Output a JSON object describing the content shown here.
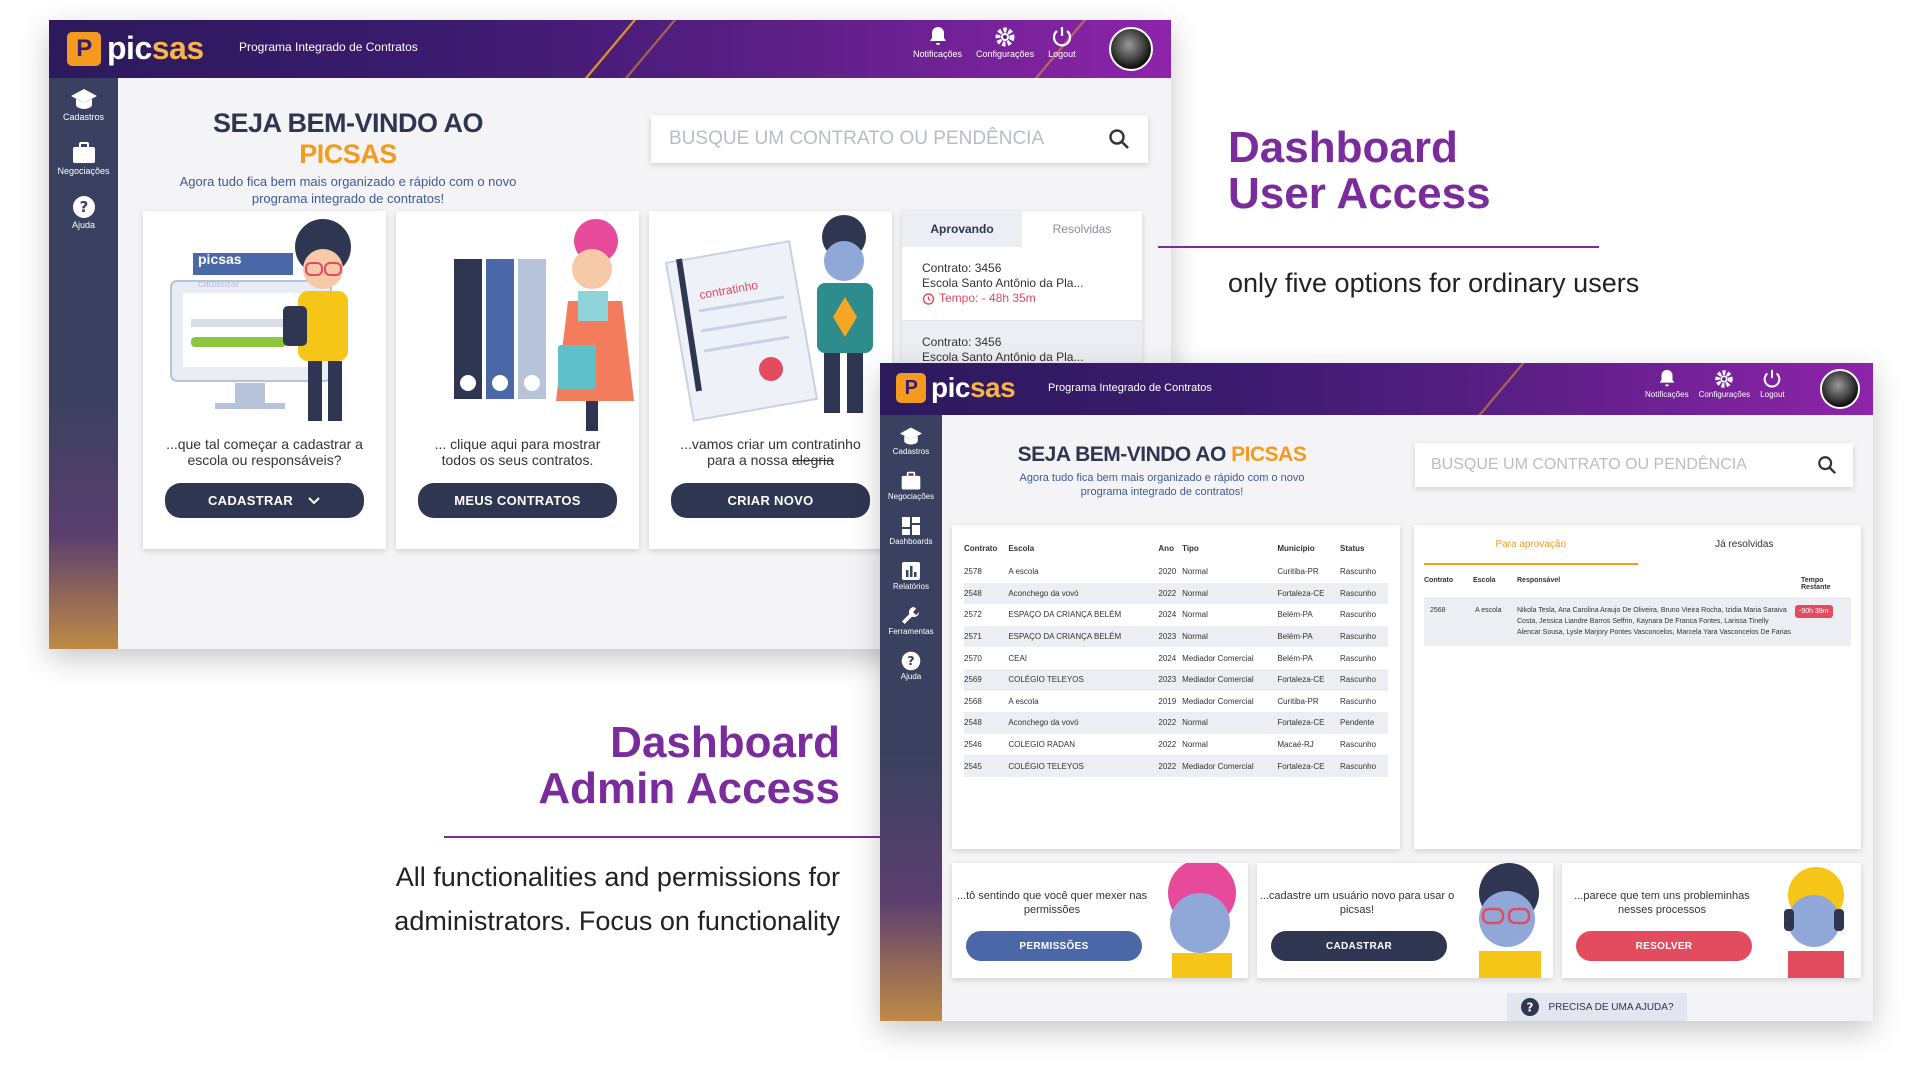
{
  "brand": {
    "logo_letter": "P",
    "name_part1": "pic",
    "name_part2": "sas",
    "tagline": "Programa Integrado de Contratos"
  },
  "topbar": {
    "notifications": "Notificações",
    "settings": "Configurações",
    "logout": "Logout"
  },
  "icons": {
    "notifications": "bell-icon",
    "settings": "gear-icon",
    "logout": "power-icon",
    "search": "search-icon",
    "help": "question-icon"
  },
  "colors": {
    "brand_purple": "#7b2c9c",
    "accent_orange": "#f39a1f",
    "navy": "#2f3651",
    "danger": "#e34b5f",
    "primary_blue": "#4a68a8"
  },
  "welcome": {
    "title_prefix": "SEJA BEM-VINDO AO ",
    "title_brand": "PICSAS",
    "subtitle": "Agora tudo fica bem mais organizado e rápido com o novo programa integrado de contratos!"
  },
  "search": {
    "placeholder": "BUSQUE UM CONTRATO OU PENDÊNCIA"
  },
  "user_dashboard": {
    "sidebar": [
      {
        "label": "Cadastros"
      },
      {
        "label": "Negociações"
      },
      {
        "label": "Ajuda"
      }
    ],
    "cards": [
      {
        "caption": "...que tal começar a cadastrar a escola ou responsáveis?",
        "button": "CADASTRAR",
        "screen_logo": "picsas",
        "screen_field": "cadastrar"
      },
      {
        "caption": "... clique aqui para mostrar todos os seus contratos.",
        "button": "MEUS CONTRATOS"
      },
      {
        "caption_part1": "...vamos criar um contratinho para a nossa ",
        "caption_strike": "alegria",
        "button": "CRIAR NOVO",
        "doc_label": "contratinho"
      }
    ],
    "panel": {
      "tabs": [
        "Aprovando",
        "Resolvidas"
      ],
      "items": [
        {
          "contract": "Contrato: 3456",
          "school": "Escola Santo Antônio da Pla...",
          "time": "Tempo: - 48h 35m"
        },
        {
          "contract": "Contrato: 3456",
          "school": "Escola Santo Antônio da Pla..."
        }
      ]
    }
  },
  "admin_dashboard": {
    "sidebar": [
      {
        "label": "Cadastros"
      },
      {
        "label": "Negociações"
      },
      {
        "label": "Dashboards"
      },
      {
        "label": "Relatórios"
      },
      {
        "label": "Ferramentas"
      },
      {
        "label": "Ajuda"
      }
    ],
    "table": {
      "headers": [
        "Contrato",
        "Escola",
        "Ano",
        "Tipo",
        "Município",
        "Status"
      ],
      "rows": [
        [
          "2578",
          "A escola",
          "2020",
          "Normal",
          "Curitiba-PR",
          "Rascunho"
        ],
        [
          "2548",
          "Aconchego da vovó",
          "2022",
          "Normal",
          "Fortaleza-CE",
          "Rascunho"
        ],
        [
          "2572",
          "ESPAÇO DA CRIANÇA BELÉM",
          "2024",
          "Normal",
          "Belém-PA",
          "Rascunho"
        ],
        [
          "2571",
          "ESPAÇO DA CRIANÇA BELÉM",
          "2023",
          "Normal",
          "Belém-PA",
          "Rascunho"
        ],
        [
          "2570",
          "CEAI",
          "2024",
          "Mediador Comercial",
          "Belém-PA",
          "Rascunho"
        ],
        [
          "2569",
          "COLÉGIO TELEYOS",
          "2023",
          "Mediador Comercial",
          "Fortaleza-CE",
          "Rascunho"
        ],
        [
          "2568",
          "A escola",
          "2019",
          "Mediador Comercial",
          "Curitiba-PR",
          "Rascunho"
        ],
        [
          "2548",
          "Aconchego da vovó",
          "2022",
          "Normal",
          "Fortaleza-CE",
          "Pendente"
        ],
        [
          "2546",
          "COLEGIO RADAN",
          "2022",
          "Normal",
          "Macaé-RJ",
          "Rascunho"
        ],
        [
          "2545",
          "COLÉGIO TELEYOS",
          "2022",
          "Mediador Comercial",
          "Fortaleza-CE",
          "Rascunho"
        ]
      ]
    },
    "approval": {
      "tabs": [
        "Para aprovação",
        "Já resolvidas"
      ],
      "headers": [
        "Contrato",
        "Escola",
        "Responsável",
        "Tempo Restante"
      ],
      "row": {
        "contract": "2568",
        "school": "A escola",
        "responsible": "Nikola Tesla, Ana Carolina Araujo De Oliveira, Bruno Vieira Rocha, Izidia Maria Saraiva Costa, Jessica Liandre Barros Seffrin, Kaynara De Franca Fontes, Larissa Tinelly Alencar Sousa, Lysle Marjory Pontes Vasconcelos, Marcela Yara Vasconcelos De Farias",
        "time": "-90h 39m"
      }
    },
    "cards": [
      {
        "caption": "...tô sentindo que você quer mexer nas permissões",
        "button": "PERMISSÕES"
      },
      {
        "caption": "...cadastre um usuário novo para usar o picsas!",
        "button": "CADASTRAR"
      },
      {
        "caption": "...parece que tem uns probleminhas nesses processos",
        "button": "RESOLVER"
      }
    ],
    "help_button": "PRECISA DE UMA AJUDA?"
  },
  "annotations": {
    "user": {
      "title_line1": "Dashboard",
      "title_line2": "User Access",
      "description": "only five options for ordinary users"
    },
    "admin": {
      "title_line1": "Dashboard",
      "title_line2": "Admin Access",
      "description_line1": "All functionalities and permissions for",
      "description_line2": "administrators. Focus on functionality"
    }
  }
}
